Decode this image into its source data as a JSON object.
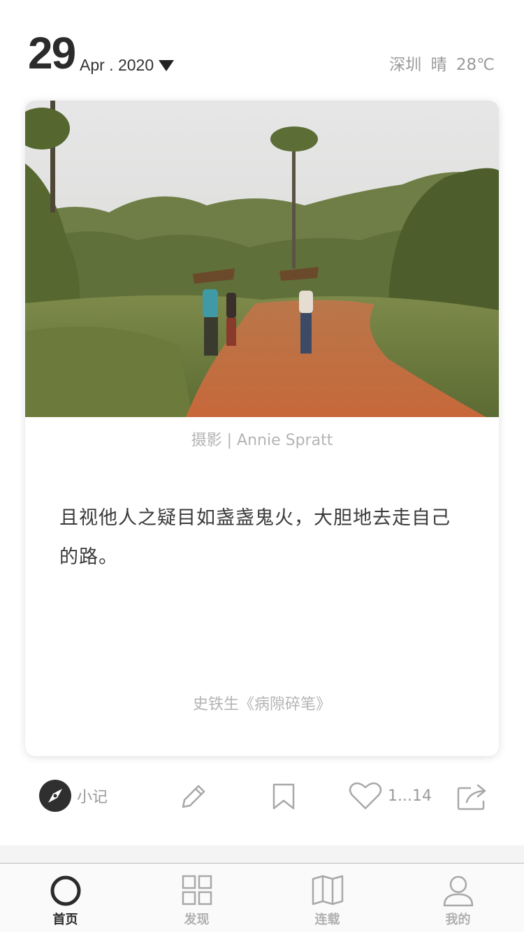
{
  "header": {
    "day": "29",
    "month_year": "Apr . 2020",
    "weather": "深圳  晴  28℃"
  },
  "card": {
    "photo_alt": "dirt road through palm trees with people carrying firewood",
    "photo_credit": "摄影 | Annie Spratt",
    "quote": "且视他人之疑目如盏盏鬼火，大胆地去走自己的路。",
    "source": "史铁生《病隙碎笔》"
  },
  "actions": {
    "note_label": "小记",
    "like_count": "1...14",
    "icons": [
      "compass-icon",
      "pencil-icon",
      "bookmark-icon",
      "heart-icon",
      "share-icon"
    ]
  },
  "tabs": [
    {
      "label": "首页",
      "icon": "circle-icon",
      "active": true
    },
    {
      "label": "发现",
      "icon": "grid-icon",
      "active": false
    },
    {
      "label": "连载",
      "icon": "book-icon",
      "active": false
    },
    {
      "label": "我的",
      "icon": "person-icon",
      "active": false
    }
  ],
  "colors": {
    "text_dark": "#2b2b2b",
    "text_muted": "#9a9a9a",
    "icon_grey": "#a8a8a8"
  }
}
